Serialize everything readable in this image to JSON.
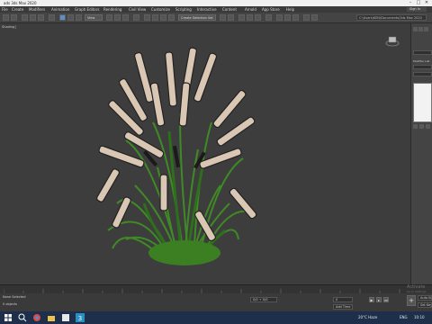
{
  "window": {
    "title": "ads 3ds Max 2020",
    "controls": [
      "–",
      "□",
      "✕"
    ]
  },
  "menu": {
    "items": [
      "File",
      "Create",
      "Modifiers",
      "Animation",
      "Graph Editors",
      "Rendering",
      "Civil View",
      "Customize",
      "Scripting",
      "Interactive",
      "Content",
      "Arnold",
      "App Store",
      "Help"
    ],
    "sign_in": "Sign In"
  },
  "toolbar": {
    "view_dropdown": "View",
    "selection_set": "Create Selection Set",
    "project_path": "C:\\Users\\KEN\\Documents\\3ds Max 2020"
  },
  "viewport": {
    "label": "Shading]",
    "bg_color": "#3d3d3d",
    "grass_color": "#3f8a25",
    "seed_color": "#d9c7b4"
  },
  "command_panel": {
    "modifier_list_label": "Modifier List"
  },
  "statusbar": {
    "selection_text": "None Selected",
    "objects_text": "0 objects",
    "add_time_tag": "Add Time Tag",
    "coords": "0/0 ÷ 0/0",
    "auto_key": "Auto Key",
    "set_key": "Set Key",
    "frame": "0"
  },
  "watermark": {
    "line1": "Activate",
    "line2": "Go to Settings"
  },
  "taskbar": {
    "temp": "20°C  Haze",
    "lang": "ENG",
    "time": "10:10"
  }
}
